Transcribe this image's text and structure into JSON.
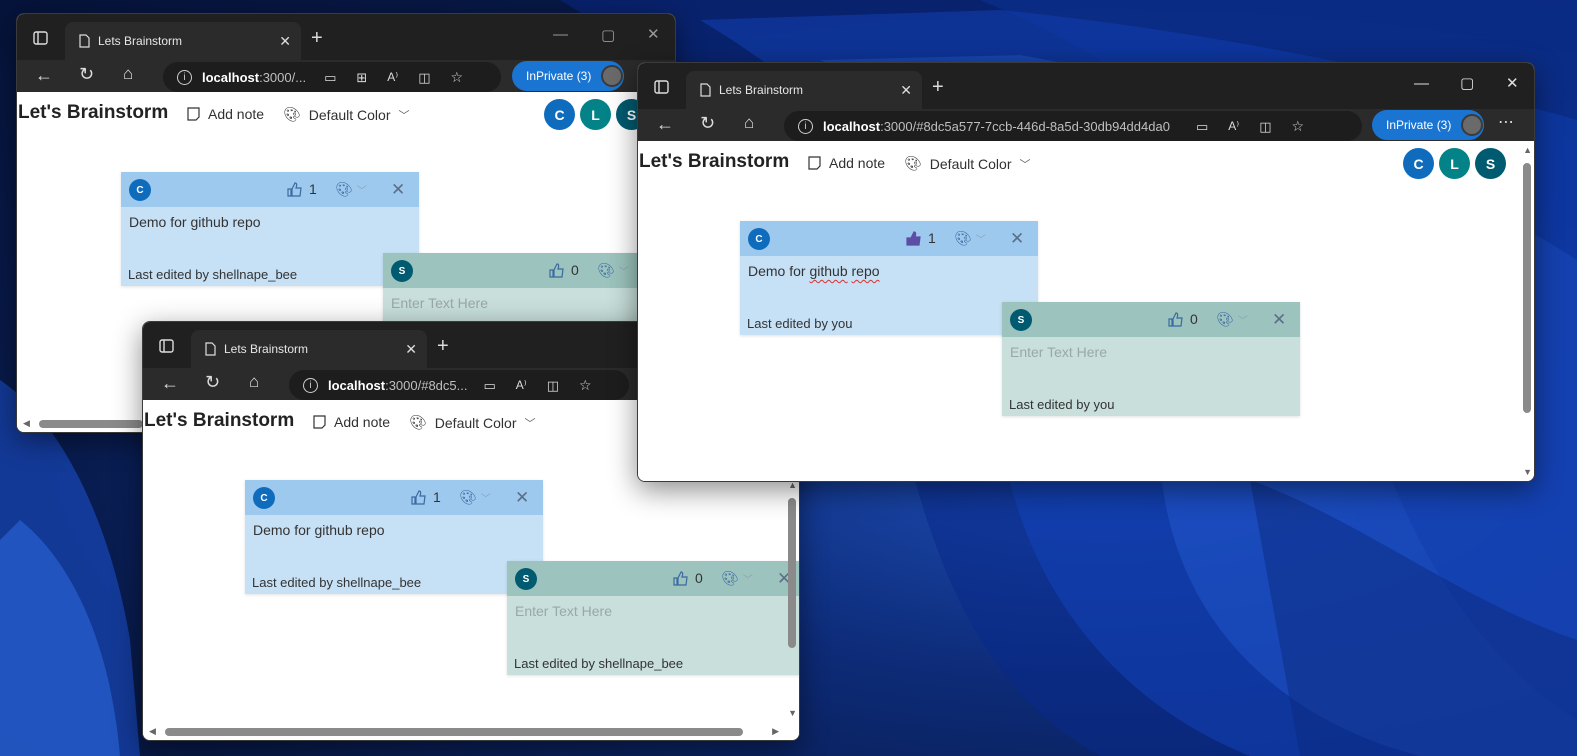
{
  "browser": {
    "tab_title": "Lets Brainstorm",
    "inprivate_label": "InPrivate (3)"
  },
  "app": {
    "title": "Let's Brainstorm",
    "add_note_label": "Add note",
    "default_color_label": "Default Color",
    "avatars": [
      "C",
      "L",
      "S"
    ],
    "colors": {
      "c": "#0f6cbd",
      "l": "#038387",
      "s": "#005b70"
    }
  },
  "windows": [
    {
      "address_host": "localhost",
      "address_path": ":3000/...",
      "notes": [
        {
          "avatar": "C",
          "likes": "1",
          "text": "Demo for github repo",
          "footer": "Last edited by shellnape_bee"
        },
        {
          "avatar": "S",
          "likes": "0",
          "text": "Enter Text Here",
          "footer": ""
        }
      ]
    },
    {
      "address_host": "localhost",
      "address_path": ":3000/#8dc5...",
      "notes": [
        {
          "avatar": "C",
          "likes": "1",
          "text": "Demo for github repo",
          "footer": "Last edited by shellnape_bee"
        },
        {
          "avatar": "S",
          "likes": "0",
          "text": "Enter Text Here",
          "footer": "Last edited by shellnape_bee"
        }
      ]
    },
    {
      "address_host": "localhost",
      "address_path": ":3000/#8dc5a577-7ccb-446d-8a5d-30db94dd4da0",
      "notes": [
        {
          "avatar": "C",
          "likes": "1",
          "text_part1": "Demo for ",
          "text_part2": "github",
          "text_part3": " ",
          "text_part4": "repo",
          "footer": "Last edited by you"
        },
        {
          "avatar": "S",
          "likes": "0",
          "text": "Enter Text Here",
          "footer": "Last edited by you"
        }
      ]
    }
  ]
}
